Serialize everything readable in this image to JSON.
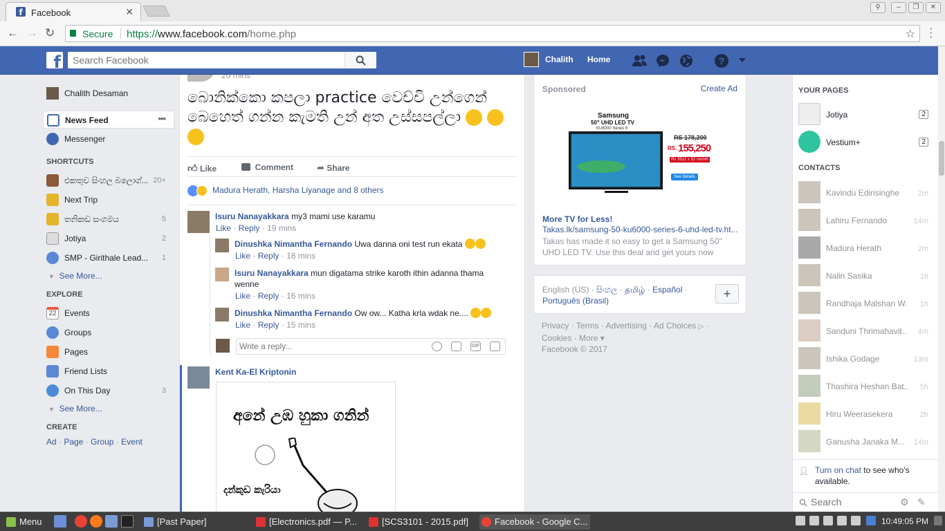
{
  "browser": {
    "tab_title": "Facebook",
    "secure_label": "Secure",
    "url_scheme": "https://",
    "url_host": "www.facebook.com",
    "url_path": "/home.php"
  },
  "fb_bar": {
    "search_placeholder": "Search Facebook",
    "user_name": "Chalith",
    "home_label": "Home"
  },
  "left_nav": {
    "profile_name": "Chalith Desaman",
    "news_feed": "News Feed",
    "news_feed_more": "•••",
    "messenger": "Messenger",
    "shortcuts_header": "SHORTCUTS",
    "shortcuts": [
      {
        "label": "එකතුව සිංහල බලොග්...",
        "count": "20+"
      },
      {
        "label": "Next Trip",
        "count": ""
      },
      {
        "label": "තනිකඩ සංගමය",
        "count": "5"
      },
      {
        "label": "Jotiya",
        "count": "2"
      },
      {
        "label": "SMP - Girithale Lead...",
        "count": "1"
      }
    ],
    "see_more": "See More...",
    "explore_header": "EXPLORE",
    "explore": [
      {
        "label": "Events",
        "count": ""
      },
      {
        "label": "Groups",
        "count": ""
      },
      {
        "label": "Pages",
        "count": ""
      },
      {
        "label": "Friend Lists",
        "count": ""
      },
      {
        "label": "On This Day",
        "count": "3"
      }
    ],
    "events_date": "22",
    "create_header": "CREATE",
    "create_links": [
      "Ad",
      "Page",
      "Group",
      "Event"
    ],
    "create_sep": "·"
  },
  "post": {
    "time_partial": "20 mins",
    "text": "බොනික්කො කපලා practice වෙච්චි උන්ගෙන් බෙහෙත් ගන්න කැමති උන් අත උස්සපල්ලා",
    "like": "Like",
    "comment": "Comment",
    "share": "Share",
    "reactions": "Madura Herath, Harsha Liyanage and 8 others",
    "comments": [
      {
        "name": "Isuru Nanayakkara",
        "text": "my3 mami use karamu",
        "like": "Like",
        "reply": "Reply",
        "time": "19 mins"
      },
      {
        "name": "Dinushka Nimantha Fernando",
        "text": "Uwa danna oni test run ekata",
        "like": "Like",
        "reply": "Reply",
        "time": "18 mins"
      },
      {
        "name": "Isuru Nanayakkara",
        "text": "mun digatama strike karoth ithin adanna thama wenne",
        "like": "Like",
        "reply": "Reply",
        "time": "16 mins"
      },
      {
        "name": "Dinushka Nimantha Fernando",
        "text": "Ow ow... Katha krla wdak ne....",
        "like": "Like",
        "reply": "Reply",
        "time": "15 mins"
      }
    ],
    "reply_placeholder": "Write a reply...",
    "gif": "GIF",
    "sep": "·",
    "next_commenter": "Kent Ka-El Kriptonin",
    "meme_line1": "අනේ උඹ හුකා ගනින්",
    "meme_line2": "දන්කුඩ කැරියා"
  },
  "ad": {
    "sponsored": "Sponsored",
    "create_ad": "Create Ad",
    "brand": "Samsung",
    "model": "50\" UHD LED TV",
    "series": "KU6000 Series 6",
    "old_price": "RS 178,200",
    "price_prefix": "RS.",
    "price": "155,250",
    "installment": "Rs 3512 x 52 month",
    "see_details": "See Details",
    "headline": "More TV for Less!",
    "link": "Takas.lk/samsung-50-ku6000-series-6-uhd-led-tv.ht...",
    "desc": "Takas has made it so easy to get a Samsung 50\" UHD LED TV. Use this deal and get yours now"
  },
  "languages": {
    "current": "English (US)",
    "others": [
      "සිංහල",
      "தமிழ்",
      "Español",
      "Português (Brasil)"
    ],
    "sep": "·",
    "plus": "+"
  },
  "footer": {
    "links": [
      "Privacy",
      "Terms",
      "Advertising",
      "Ad Choices",
      "Cookies",
      "More"
    ],
    "sep": "·",
    "more_caret": "▾",
    "copyright": "Facebook © 2017"
  },
  "chat": {
    "your_pages_header": "YOUR PAGES",
    "pages": [
      {
        "name": "Jotiya",
        "badge": "2"
      },
      {
        "name": "Vestium+",
        "badge": "2"
      }
    ],
    "contacts_header": "CONTACTS",
    "contacts": [
      {
        "name": "Kavindu Edirisinghe",
        "time": "2m"
      },
      {
        "name": "Lahiru Fernando",
        "time": "14m"
      },
      {
        "name": "Madura Herath",
        "time": "2m"
      },
      {
        "name": "Nalin Sasika",
        "time": "1h"
      },
      {
        "name": "Randhaja Malshan W...",
        "time": "1h"
      },
      {
        "name": "Sanduni Thrimahavit...",
        "time": "4m"
      },
      {
        "name": "Ishika Godage",
        "time": "13m"
      },
      {
        "name": "Thashira Heshan Bat...",
        "time": "5h"
      },
      {
        "name": "Hiru Weerasekera",
        "time": "2h"
      },
      {
        "name": "Ganusha Janaka M...",
        "time": "14m"
      }
    ],
    "turn_on_link": "Turn on chat",
    "turn_on_rest": " to see who's available.",
    "search_placeholder": "Search"
  },
  "taskbar": {
    "menu": "Menu",
    "windows": [
      "[Past Paper]",
      "[Electronics.pdf — P...",
      "[SCS3101 - 2015.pdf]",
      "Facebook - Google C..."
    ],
    "clock": "10:49:05 PM"
  },
  "colors": {
    "fb_blue": "#4267b2",
    "link": "#365899",
    "secure_green": "#0b8043"
  }
}
